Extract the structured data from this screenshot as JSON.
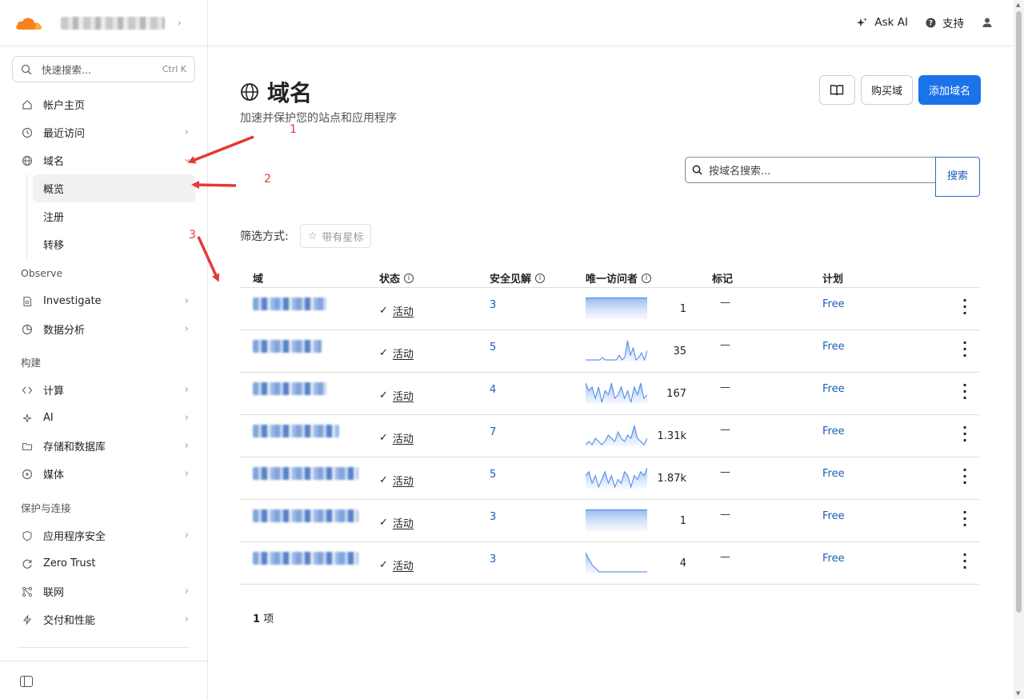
{
  "colors": {
    "accent": "#1a73e8",
    "link": "#1a5fb4",
    "cloudflare_orange": "#f6821f",
    "annotation": "#e53935"
  },
  "search": {
    "placeholder": "快速搜索...",
    "shortcut": "Ctrl K"
  },
  "sidebar": {
    "items_top": [
      {
        "label": "帐户主页",
        "icon": "home-icon",
        "chevron": false
      },
      {
        "label": "最近访问",
        "icon": "clock-icon",
        "chevron": true
      },
      {
        "label": "域名",
        "icon": "globe-icon",
        "chevron": true
      }
    ],
    "subitems": [
      "概览",
      "注册",
      "转移"
    ],
    "section_observe": "Observe",
    "items_observe": [
      {
        "label": "Investigate",
        "icon": "document-search-icon"
      },
      {
        "label": "数据分析",
        "icon": "pie-chart-icon"
      }
    ],
    "section_build": "构建",
    "items_build": [
      {
        "label": "计算",
        "icon": "code-icon"
      },
      {
        "label": "AI",
        "icon": "sparkle-icon"
      },
      {
        "label": "存储和数据库",
        "icon": "folder-icon"
      },
      {
        "label": "媒体",
        "icon": "play-icon"
      }
    ],
    "section_protect": "保护与连接",
    "items_protect": [
      {
        "label": "应用程序安全",
        "icon": "shield-icon",
        "chevron": true
      },
      {
        "label": "Zero Trust",
        "icon": "refresh-icon",
        "chevron": false
      },
      {
        "label": "联网",
        "icon": "network-icon",
        "chevron": true
      },
      {
        "label": "交付和性能",
        "icon": "bolt-icon",
        "chevron": true
      }
    ]
  },
  "topbar": {
    "ask_ai": "Ask AI",
    "support": "支持"
  },
  "page": {
    "title": "域名",
    "subtitle": "加速并保护您的站点和应用程序",
    "buy_domain": "购买域",
    "add_domain": "添加域名",
    "domain_search_placeholder": "按域名搜索...",
    "domain_search_button": "搜索",
    "filter_label": "筛选方式:",
    "starred": "带有星标",
    "count_num": "1",
    "count_unit": "项"
  },
  "table": {
    "columns": [
      "域",
      "状态",
      "安全见解",
      "唯一访问者",
      "标记",
      "计划"
    ],
    "rows": [
      {
        "status": "活动",
        "insights": "3",
        "visitors": "1",
        "tag": "—",
        "plan": "Free",
        "spark": [
          1,
          1,
          1,
          1,
          1,
          1,
          1,
          1,
          1,
          1
        ]
      },
      {
        "status": "活动",
        "insights": "5",
        "visitors": "35",
        "tag": "—",
        "plan": "Free",
        "spark": [
          0,
          0,
          0,
          0,
          0,
          0,
          1,
          0,
          0,
          0,
          0,
          0,
          2,
          0,
          1,
          8,
          2,
          5,
          0,
          1,
          3,
          0,
          4
        ]
      },
      {
        "status": "活动",
        "insights": "4",
        "visitors": "167",
        "tag": "—",
        "plan": "Free",
        "spark": [
          6,
          4,
          5,
          2,
          5,
          1,
          4,
          3,
          6,
          2,
          3,
          5,
          2,
          4,
          1,
          5,
          3,
          6,
          2,
          3
        ]
      },
      {
        "status": "活动",
        "insights": "7",
        "visitors": "1.31k",
        "tag": "—",
        "plan": "Free",
        "spark": [
          1,
          2,
          1,
          3,
          2,
          1,
          2,
          4,
          3,
          2,
          5,
          3,
          2,
          4,
          3,
          7,
          3,
          2,
          1,
          3
        ]
      },
      {
        "status": "活动",
        "insights": "5",
        "visitors": "1.87k",
        "tag": "—",
        "plan": "Free",
        "spark": [
          5,
          6,
          3,
          5,
          2,
          4,
          6,
          3,
          5,
          2,
          4,
          3,
          6,
          5,
          2,
          5,
          4,
          6,
          5,
          7
        ]
      },
      {
        "status": "活动",
        "insights": "3",
        "visitors": "1",
        "tag": "—",
        "plan": "Free",
        "spark": [
          1,
          1,
          1,
          1,
          1,
          1,
          1,
          1,
          1,
          1
        ]
      },
      {
        "status": "活动",
        "insights": "3",
        "visitors": "4",
        "tag": "—",
        "plan": "Free",
        "spark": [
          4,
          2,
          1,
          1,
          1,
          1,
          1,
          1,
          1,
          1
        ]
      }
    ]
  },
  "annotations": [
    "1",
    "2",
    "3"
  ]
}
